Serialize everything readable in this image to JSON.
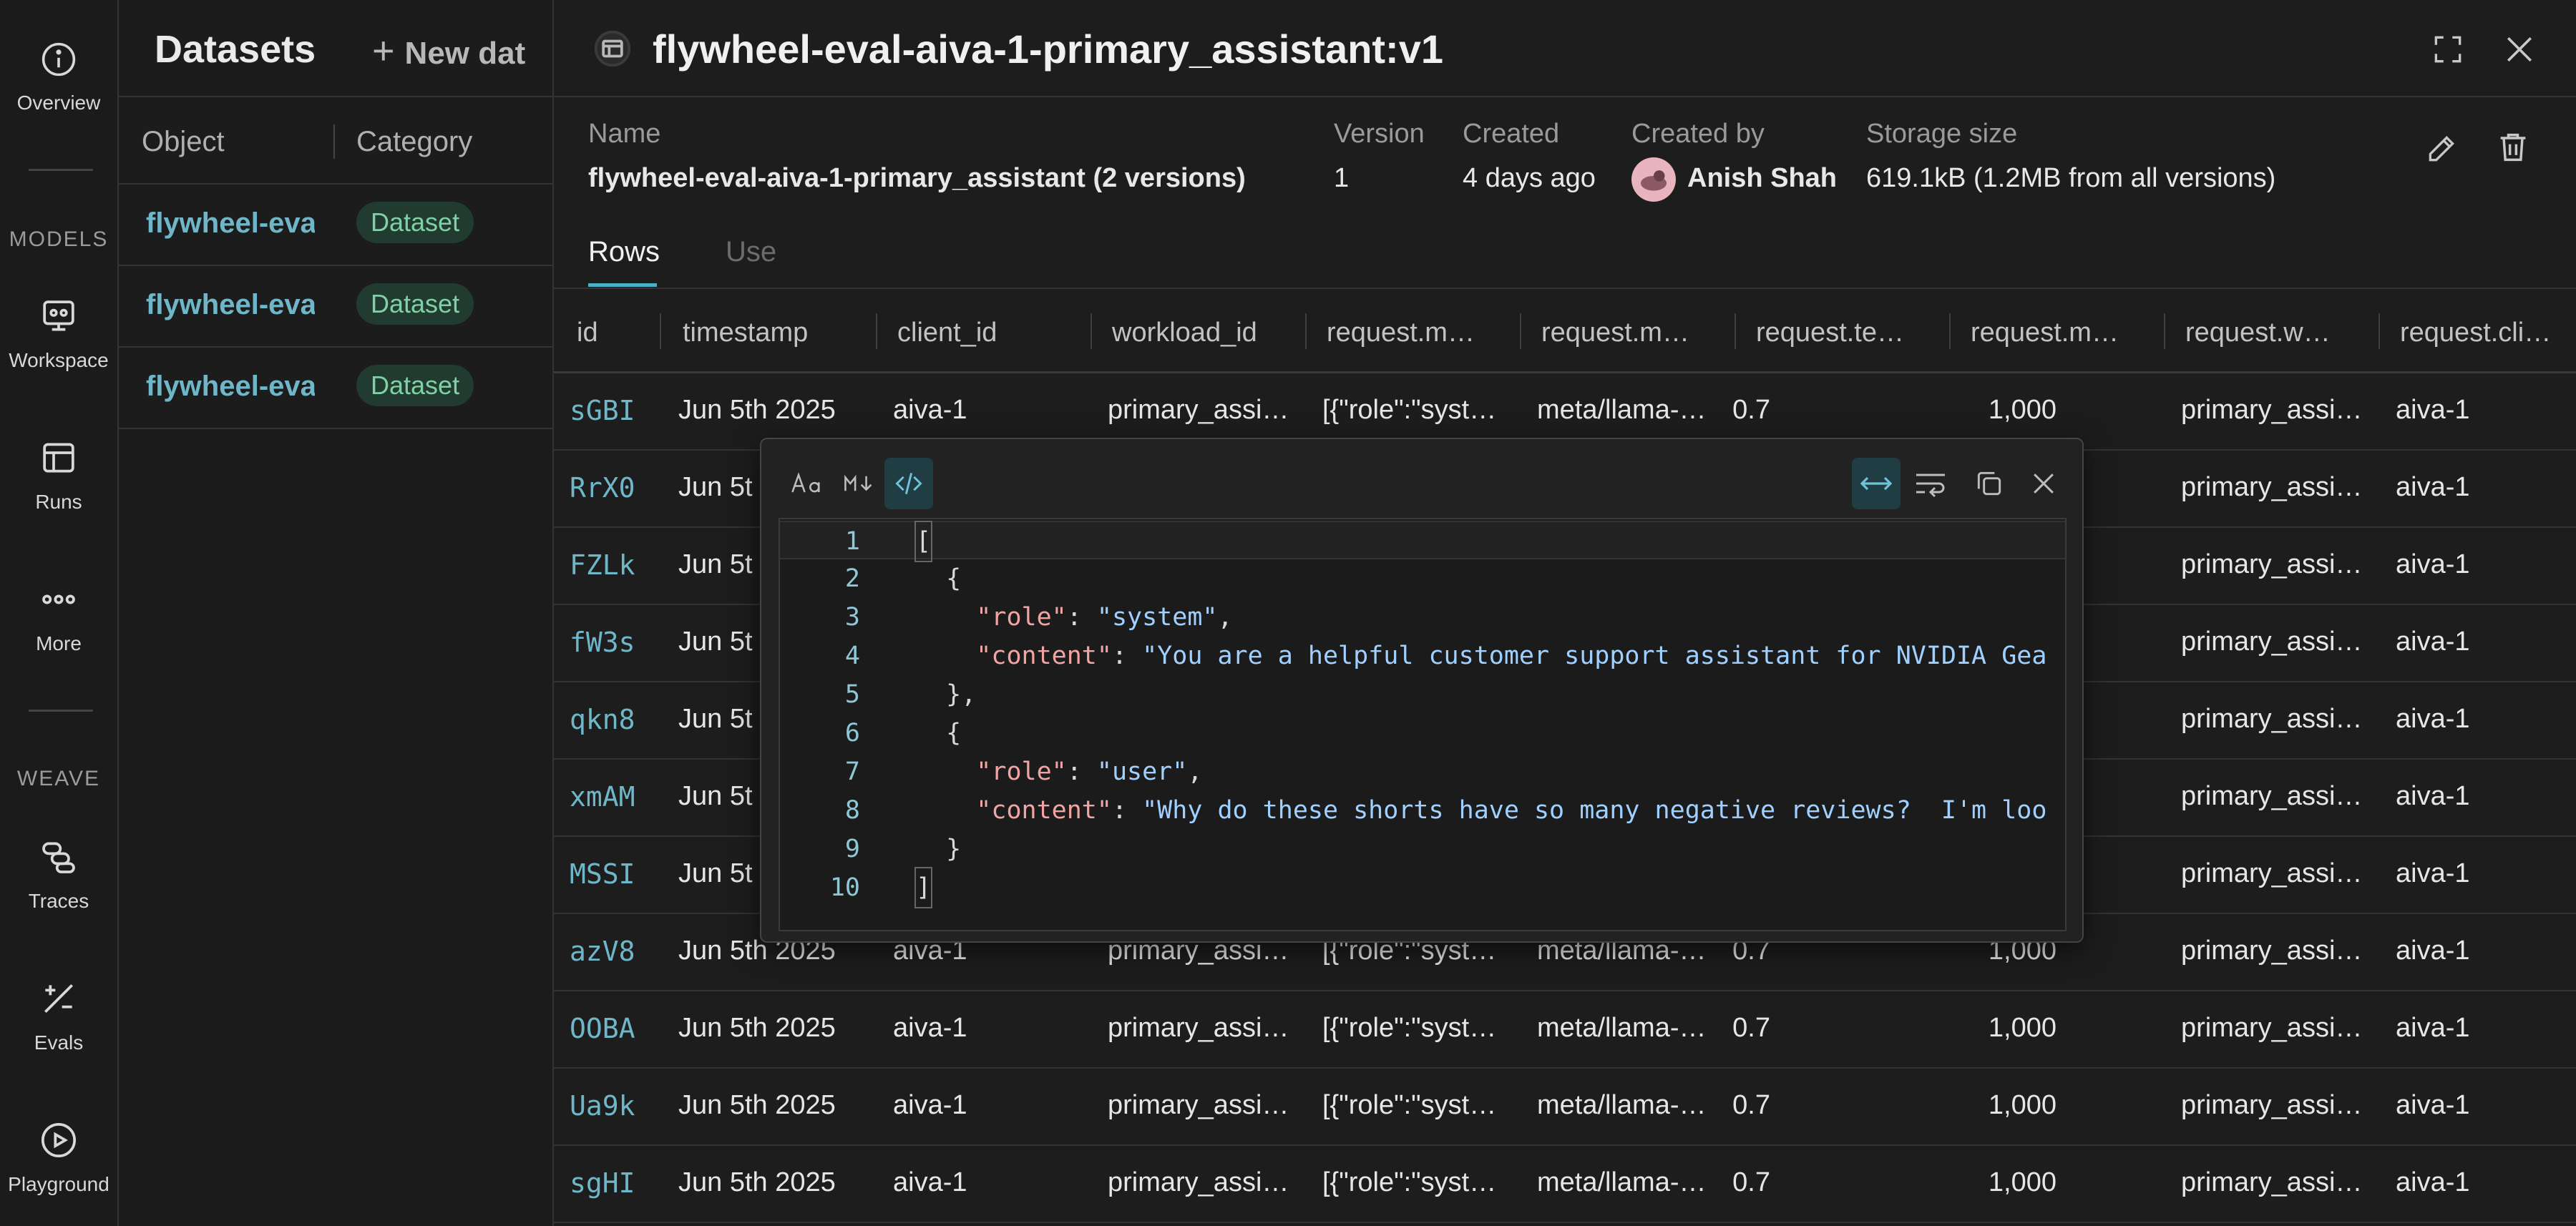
{
  "nav": {
    "overview": "Overview",
    "models_section": "MODELS",
    "workspace": "Workspace",
    "runs": "Runs",
    "more": "More",
    "weave_section": "WEAVE",
    "traces": "Traces",
    "evals": "Evals",
    "playground": "Playground"
  },
  "datasets": {
    "title": "Datasets",
    "new_label": "New dat",
    "col_object": "Object",
    "col_category": "Category",
    "rows": [
      {
        "name": "flywheel-eva",
        "category": "Dataset"
      },
      {
        "name": "flywheel-eva",
        "category": "Dataset"
      },
      {
        "name": "flywheel-eva",
        "category": "Dataset"
      }
    ]
  },
  "drawer": {
    "title": "flywheel-eval-aiva-1-primary_assistant:v1",
    "name_label": "Name",
    "name_value": "flywheel-eval-aiva-1-primary_assistant (2 versions)",
    "version_label": "Version",
    "version_value": "1",
    "created_label": "Created",
    "created_value": "4 days ago",
    "created_by_label": "Created by",
    "created_by_value": "Anish Shah",
    "storage_label": "Storage size",
    "storage_value": "619.1kB (1.2MB from all versions)",
    "tabs": {
      "rows": "Rows",
      "use": "Use"
    }
  },
  "table": {
    "columns": [
      "id",
      "timestamp",
      "client_id",
      "workload_id",
      "request.m…",
      "request.m…",
      "request.te…",
      "request.m…",
      "request.w…",
      "request.cli…"
    ],
    "rows": [
      {
        "id": "sGBI",
        "timestamp": "Jun 5th 2025 at",
        "client_id": "aiva-1",
        "workload_id": "primary_assi…",
        "messages": "[{\"role\":\"syst…",
        "model": "meta/llama-…",
        "temperature": "0.7",
        "max_tokens": "1,000",
        "workload": "primary_assi…",
        "client": "aiva-1"
      },
      {
        "id": "RrX0",
        "timestamp": "Jun 5t",
        "client_id": "",
        "workload_id": "",
        "messages": "",
        "model": "",
        "temperature": "",
        "max_tokens": "1,000",
        "workload": "primary_assi…",
        "client": "aiva-1"
      },
      {
        "id": "FZLk",
        "timestamp": "Jun 5t",
        "client_id": "",
        "workload_id": "",
        "messages": "",
        "model": "",
        "temperature": "",
        "max_tokens": "1,000",
        "workload": "primary_assi…",
        "client": "aiva-1"
      },
      {
        "id": "fW3s",
        "timestamp": "Jun 5t",
        "client_id": "",
        "workload_id": "",
        "messages": "",
        "model": "",
        "temperature": "",
        "max_tokens": "1,000",
        "workload": "primary_assi…",
        "client": "aiva-1"
      },
      {
        "id": "qkn8",
        "timestamp": "Jun 5t",
        "client_id": "",
        "workload_id": "",
        "messages": "",
        "model": "",
        "temperature": "",
        "max_tokens": "1,000",
        "workload": "primary_assi…",
        "client": "aiva-1"
      },
      {
        "id": "xmAM",
        "timestamp": "Jun 5t",
        "client_id": "",
        "workload_id": "",
        "messages": "",
        "model": "",
        "temperature": "",
        "max_tokens": "1,000",
        "workload": "primary_assi…",
        "client": "aiva-1"
      },
      {
        "id": "MSSI",
        "timestamp": "Jun 5t",
        "client_id": "",
        "workload_id": "",
        "messages": "",
        "model": "",
        "temperature": "",
        "max_tokens": "1,000",
        "workload": "primary_assi…",
        "client": "aiva-1"
      },
      {
        "id": "azV8",
        "timestamp": "Jun 5th 2025 at",
        "client_id": "aiva-1",
        "workload_id": "primary_assi…",
        "messages": "[{\"role\":\"syst…",
        "model": "meta/llama-…",
        "temperature": "0.7",
        "max_tokens": "1,000",
        "workload": "primary_assi…",
        "client": "aiva-1"
      },
      {
        "id": "OOBA",
        "timestamp": "Jun 5th 2025 at",
        "client_id": "aiva-1",
        "workload_id": "primary_assi…",
        "messages": "[{\"role\":\"syst…",
        "model": "meta/llama-…",
        "temperature": "0.7",
        "max_tokens": "1,000",
        "workload": "primary_assi…",
        "client": "aiva-1"
      },
      {
        "id": "Ua9k",
        "timestamp": "Jun 5th 2025 at",
        "client_id": "aiva-1",
        "workload_id": "primary_assi…",
        "messages": "[{\"role\":\"syst…",
        "model": "meta/llama-…",
        "temperature": "0.7",
        "max_tokens": "1,000",
        "workload": "primary_assi…",
        "client": "aiva-1"
      },
      {
        "id": "sgHI",
        "timestamp": "Jun 5th 2025 at",
        "client_id": "aiva-1",
        "workload_id": "primary_assi…",
        "messages": "[{\"role\":\"syst…",
        "model": "meta/llama-…",
        "temperature": "0.7",
        "max_tokens": "1,000",
        "workload": "primary_assi…",
        "client": "aiva-1"
      }
    ]
  },
  "popover": {
    "lines": [
      {
        "n": "1",
        "text": "["
      },
      {
        "n": "2",
        "text": "  {"
      },
      {
        "n": "3",
        "key": "\"role\"",
        "val": "\"system\"",
        "tail": ","
      },
      {
        "n": "4",
        "key": "\"content\"",
        "val": "\"You are a helpful customer support assistant for NVIDIA Gea",
        "tail": ""
      },
      {
        "n": "5",
        "text": "  },"
      },
      {
        "n": "6",
        "text": "  {"
      },
      {
        "n": "7",
        "key": "\"role\"",
        "val": "\"user\"",
        "tail": ","
      },
      {
        "n": "8",
        "key": "\"content\"",
        "val": "\"Why do these shorts have so many negative reviews?  I'm loo",
        "tail": ""
      },
      {
        "n": "9",
        "text": "  }"
      },
      {
        "n": "10",
        "text": "]"
      }
    ]
  },
  "colors": {
    "accent": "#4ab0c4",
    "link": "#6fb7c8",
    "badge_bg": "#213b30",
    "badge_text": "#7fd0a4",
    "json_key": "#f2a3a3",
    "json_string": "#9fd0ff"
  },
  "icons": [
    "info-icon",
    "model-icon",
    "runs-table-icon",
    "more-dots-icon",
    "traces-icon",
    "evals-icon",
    "play-icon",
    "plus-icon",
    "table-icon",
    "expand-icon",
    "close-icon",
    "edit-icon",
    "trash-icon",
    "text-format-icon",
    "markdown-icon",
    "code-icon",
    "wrap-horizontal-icon",
    "wrap-lines-icon",
    "copy-icon"
  ]
}
